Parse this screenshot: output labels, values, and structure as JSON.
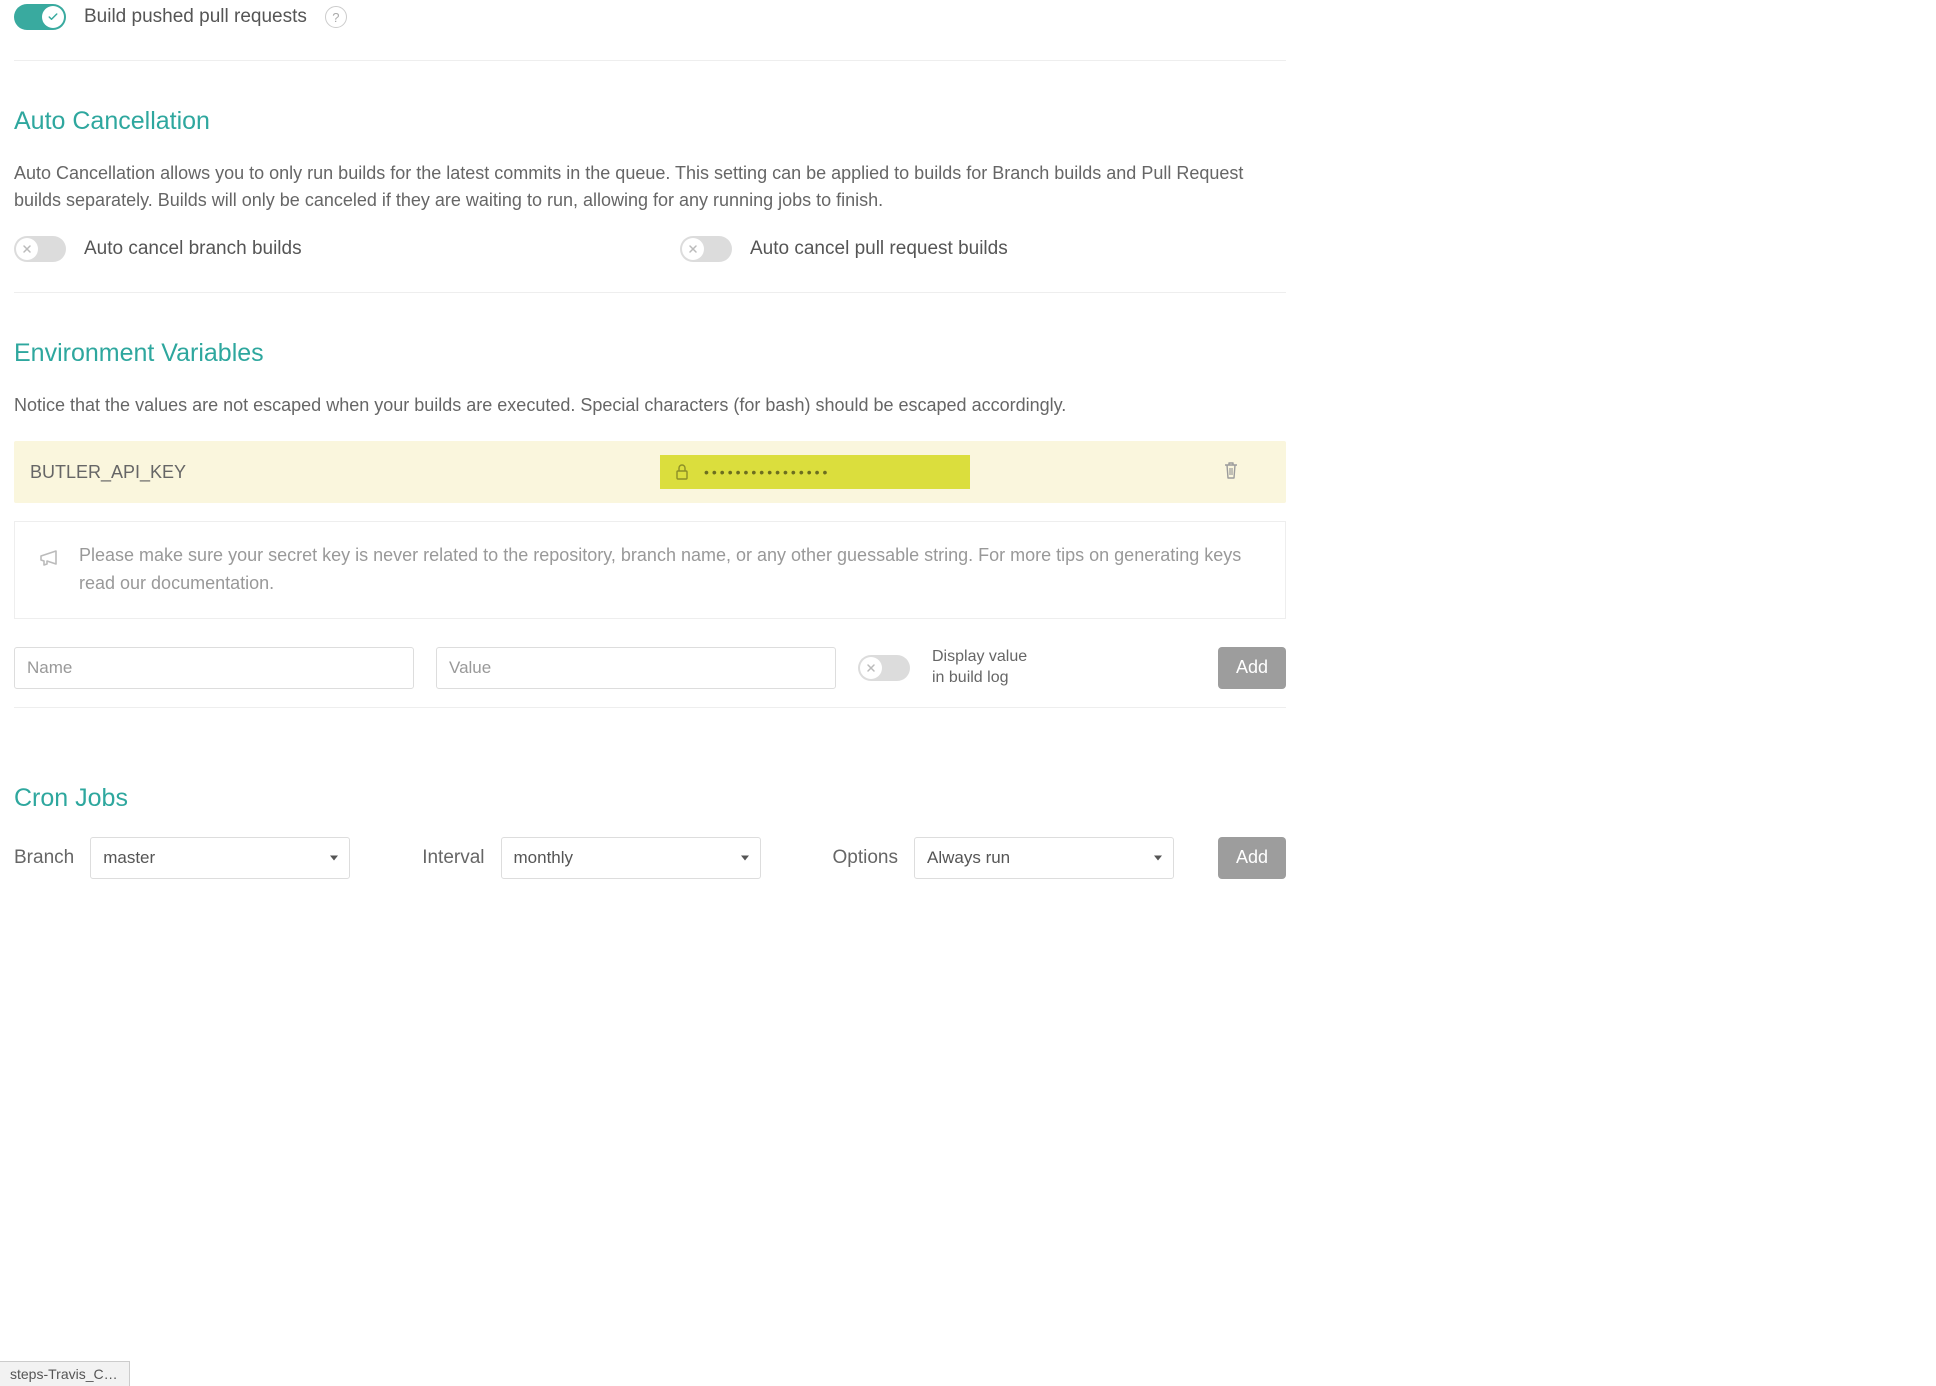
{
  "general": {
    "build_pr_label": "Build pushed pull requests"
  },
  "auto_cancel": {
    "heading": "Auto Cancellation",
    "desc": "Auto Cancellation allows you to only run builds for the latest commits in the queue. This setting can be applied to builds for Branch builds and Pull Request builds separately. Builds will only be canceled if they are waiting to run, allowing for any running jobs to finish.",
    "branch_label": "Auto cancel branch builds",
    "pr_label": "Auto cancel pull request builds"
  },
  "env": {
    "heading": "Environment Variables",
    "desc": "Notice that the values are not escaped when your builds are executed. Special characters (for bash) should be escaped accordingly.",
    "vars": [
      {
        "name": "BUTLER_API_KEY",
        "masked": "••••••••••••••••"
      }
    ],
    "info": "Please make sure your secret key is never related to the repository, branch name, or any other guessable string. For more tips on generating keys read our documentation.",
    "name_placeholder": "Name",
    "value_placeholder": "Value",
    "display_label": "Display value in build log",
    "add_label": "Add"
  },
  "cron": {
    "heading": "Cron Jobs",
    "branch_label": "Branch",
    "branch_value": "master",
    "interval_label": "Interval",
    "interval_value": "monthly",
    "options_label": "Options",
    "options_value": "Always run",
    "add_label": "Add"
  },
  "browser_tab": "steps-Travis_CI-..."
}
